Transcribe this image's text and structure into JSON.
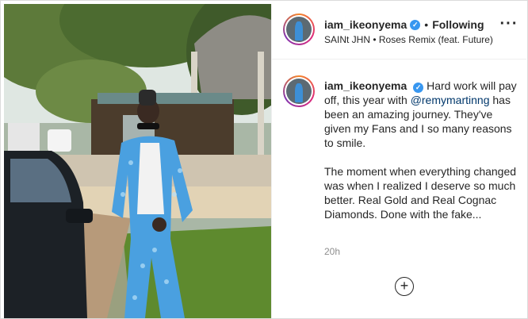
{
  "post": {
    "username": "iam_ikeonyema",
    "verified_mark": "✓",
    "separator": "•",
    "follow_state": "Following",
    "audio": "SAINt JHN • Roses Remix (feat. Future)",
    "more_icon": "···",
    "caption": {
      "username": "iam_ikeonyema",
      "text_1": " Hard work will pay off, this year with ",
      "mention": "@remymartinng",
      "text_2": " has been an amazing journey. They've given my Fans and I so many reasons to smile.",
      "paragraph_2": "The moment when everything changed was when I realized I deserve so much better. Real Gold and Real Cognac Diamonds. Done with the fake..."
    },
    "timestamp": "20h",
    "add_icon": "+"
  },
  "colors": {
    "link": "#00376b",
    "verified": "#3897f0",
    "muted": "#8e8e8e",
    "suit": "#3d8fd6"
  }
}
